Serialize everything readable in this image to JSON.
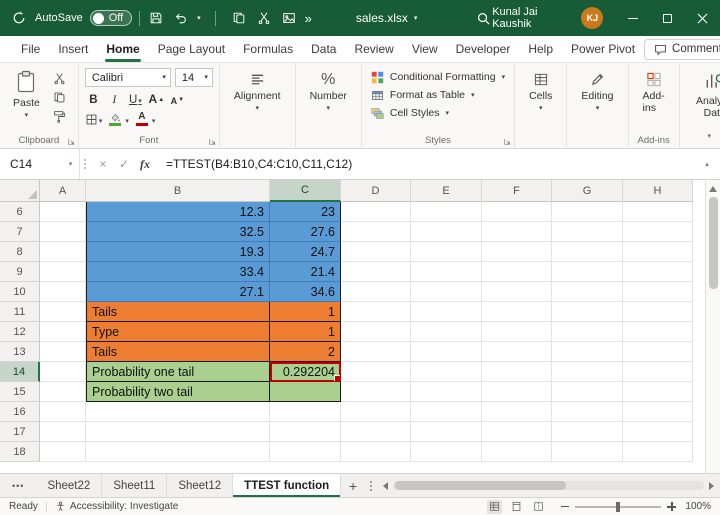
{
  "titlebar": {
    "autosave_label": "AutoSave",
    "autosave_state": "Off",
    "filename": "sales.xlsx",
    "user_name": "Kunal Jai Kaushik",
    "user_initials": "KJ",
    "more_glyph": "»"
  },
  "menubar": {
    "tabs": [
      {
        "label": "File"
      },
      {
        "label": "Insert"
      },
      {
        "label": "Home",
        "active": true
      },
      {
        "label": "Page Layout"
      },
      {
        "label": "Formulas"
      },
      {
        "label": "Data"
      },
      {
        "label": "Review"
      },
      {
        "label": "View"
      },
      {
        "label": "Developer"
      },
      {
        "label": "Help"
      },
      {
        "label": "Power Pivot"
      }
    ],
    "comments_label": "Comments"
  },
  "ribbon": {
    "paste": "Paste",
    "clipboard_group": "Clipboard",
    "font_name": "Calibri",
    "font_size": "14",
    "bold": "B",
    "italic": "I",
    "underline": "U",
    "font_letter": "A",
    "percent": "%",
    "font_group": "Font",
    "alignment": "Alignment",
    "number": "Number",
    "conditional_formatting": "Conditional Formatting",
    "format_as_table": "Format as Table",
    "cell_styles": "Cell Styles",
    "styles_group": "Styles",
    "cells": "Cells",
    "editing": "Editing",
    "addins": "Add-ins",
    "addins_group": "Add-ins",
    "analyze_data": "Analyze Data"
  },
  "formula_bar": {
    "name_box": "C14",
    "cancel_glyph": "×",
    "enter_glyph": "✓",
    "fx_label": "fx",
    "formula": "=TTEST(B4:B10,C4:C10,C11,C12)"
  },
  "grid": {
    "columns": [
      "A",
      "B",
      "C",
      "D",
      "E",
      "F",
      "G",
      "H"
    ],
    "selected_column": "C",
    "selected_row": "14",
    "active_cell": {
      "row": "14",
      "col": "C"
    },
    "rows": [
      {
        "num": "6",
        "b": "12.3",
        "c": "23",
        "style": "blue"
      },
      {
        "num": "7",
        "b": "32.5",
        "c": "27.6",
        "style": "blue"
      },
      {
        "num": "8",
        "b": "19.3",
        "c": "24.7",
        "style": "blue"
      },
      {
        "num": "9",
        "b": "33.4",
        "c": "21.4",
        "style": "blue"
      },
      {
        "num": "10",
        "b": "27.1",
        "c": "34.6",
        "style": "blue"
      },
      {
        "num": "11",
        "b": "Tails",
        "c": "1",
        "style": "orange"
      },
      {
        "num": "12",
        "b": "Type",
        "c": "1",
        "style": "orange"
      },
      {
        "num": "13",
        "b": "Tails",
        "c": "2",
        "style": "orange"
      },
      {
        "num": "14",
        "b": "Probability one tail",
        "c": "0.292204",
        "style": "green"
      },
      {
        "num": "15",
        "b": "Probability two tail",
        "c": "",
        "style": "green"
      },
      {
        "num": "16",
        "b": "",
        "c": "",
        "style": "none"
      },
      {
        "num": "17",
        "b": "",
        "c": "",
        "style": "none"
      },
      {
        "num": "18",
        "b": "",
        "c": "",
        "style": "none"
      }
    ]
  },
  "sheet_tabs": {
    "overflow": "•••",
    "tabs": [
      {
        "label": "Sheet22"
      },
      {
        "label": "Sheet11"
      },
      {
        "label": "Sheet12"
      },
      {
        "label": "TTEST function",
        "active": true
      }
    ],
    "add_label": "+"
  },
  "status_bar": {
    "ready": "Ready",
    "accessibility": "Accessibility: Investigate",
    "zoom": "100%"
  },
  "colors": {
    "titlebar_green": "#185C37",
    "accent_green": "#217346",
    "blue_fill": "#5B9BD5",
    "orange_fill": "#ED7D31",
    "green_fill": "#A9D08E",
    "selection_red": "#C00000",
    "avatar_orange": "#C97A1B"
  }
}
